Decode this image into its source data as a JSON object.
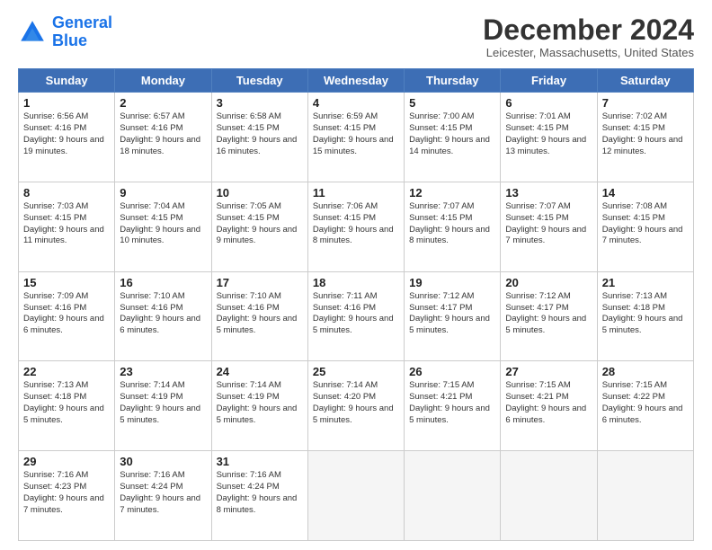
{
  "header": {
    "logo": {
      "line1": "General",
      "line2": "Blue"
    },
    "title": "December 2024",
    "location": "Leicester, Massachusetts, United States"
  },
  "columns": [
    "Sunday",
    "Monday",
    "Tuesday",
    "Wednesday",
    "Thursday",
    "Friday",
    "Saturday"
  ],
  "weeks": [
    [
      {
        "day": "1",
        "sunrise": "6:56 AM",
        "sunset": "4:16 PM",
        "daylight": "9 hours and 19 minutes."
      },
      {
        "day": "2",
        "sunrise": "6:57 AM",
        "sunset": "4:16 PM",
        "daylight": "9 hours and 18 minutes."
      },
      {
        "day": "3",
        "sunrise": "6:58 AM",
        "sunset": "4:15 PM",
        "daylight": "9 hours and 16 minutes."
      },
      {
        "day": "4",
        "sunrise": "6:59 AM",
        "sunset": "4:15 PM",
        "daylight": "9 hours and 15 minutes."
      },
      {
        "day": "5",
        "sunrise": "7:00 AM",
        "sunset": "4:15 PM",
        "daylight": "9 hours and 14 minutes."
      },
      {
        "day": "6",
        "sunrise": "7:01 AM",
        "sunset": "4:15 PM",
        "daylight": "9 hours and 13 minutes."
      },
      {
        "day": "7",
        "sunrise": "7:02 AM",
        "sunset": "4:15 PM",
        "daylight": "9 hours and 12 minutes."
      }
    ],
    [
      {
        "day": "8",
        "sunrise": "7:03 AM",
        "sunset": "4:15 PM",
        "daylight": "9 hours and 11 minutes."
      },
      {
        "day": "9",
        "sunrise": "7:04 AM",
        "sunset": "4:15 PM",
        "daylight": "9 hours and 10 minutes."
      },
      {
        "day": "10",
        "sunrise": "7:05 AM",
        "sunset": "4:15 PM",
        "daylight": "9 hours and 9 minutes."
      },
      {
        "day": "11",
        "sunrise": "7:06 AM",
        "sunset": "4:15 PM",
        "daylight": "9 hours and 8 minutes."
      },
      {
        "day": "12",
        "sunrise": "7:07 AM",
        "sunset": "4:15 PM",
        "daylight": "9 hours and 8 minutes."
      },
      {
        "day": "13",
        "sunrise": "7:07 AM",
        "sunset": "4:15 PM",
        "daylight": "9 hours and 7 minutes."
      },
      {
        "day": "14",
        "sunrise": "7:08 AM",
        "sunset": "4:15 PM",
        "daylight": "9 hours and 7 minutes."
      }
    ],
    [
      {
        "day": "15",
        "sunrise": "7:09 AM",
        "sunset": "4:16 PM",
        "daylight": "9 hours and 6 minutes."
      },
      {
        "day": "16",
        "sunrise": "7:10 AM",
        "sunset": "4:16 PM",
        "daylight": "9 hours and 6 minutes."
      },
      {
        "day": "17",
        "sunrise": "7:10 AM",
        "sunset": "4:16 PM",
        "daylight": "9 hours and 5 minutes."
      },
      {
        "day": "18",
        "sunrise": "7:11 AM",
        "sunset": "4:16 PM",
        "daylight": "9 hours and 5 minutes."
      },
      {
        "day": "19",
        "sunrise": "7:12 AM",
        "sunset": "4:17 PM",
        "daylight": "9 hours and 5 minutes."
      },
      {
        "day": "20",
        "sunrise": "7:12 AM",
        "sunset": "4:17 PM",
        "daylight": "9 hours and 5 minutes."
      },
      {
        "day": "21",
        "sunrise": "7:13 AM",
        "sunset": "4:18 PM",
        "daylight": "9 hours and 5 minutes."
      }
    ],
    [
      {
        "day": "22",
        "sunrise": "7:13 AM",
        "sunset": "4:18 PM",
        "daylight": "9 hours and 5 minutes."
      },
      {
        "day": "23",
        "sunrise": "7:14 AM",
        "sunset": "4:19 PM",
        "daylight": "9 hours and 5 minutes."
      },
      {
        "day": "24",
        "sunrise": "7:14 AM",
        "sunset": "4:19 PM",
        "daylight": "9 hours and 5 minutes."
      },
      {
        "day": "25",
        "sunrise": "7:14 AM",
        "sunset": "4:20 PM",
        "daylight": "9 hours and 5 minutes."
      },
      {
        "day": "26",
        "sunrise": "7:15 AM",
        "sunset": "4:21 PM",
        "daylight": "9 hours and 5 minutes."
      },
      {
        "day": "27",
        "sunrise": "7:15 AM",
        "sunset": "4:21 PM",
        "daylight": "9 hours and 6 minutes."
      },
      {
        "day": "28",
        "sunrise": "7:15 AM",
        "sunset": "4:22 PM",
        "daylight": "9 hours and 6 minutes."
      }
    ],
    [
      {
        "day": "29",
        "sunrise": "7:16 AM",
        "sunset": "4:23 PM",
        "daylight": "9 hours and 7 minutes."
      },
      {
        "day": "30",
        "sunrise": "7:16 AM",
        "sunset": "4:24 PM",
        "daylight": "9 hours and 7 minutes."
      },
      {
        "day": "31",
        "sunrise": "7:16 AM",
        "sunset": "4:24 PM",
        "daylight": "9 hours and 8 minutes."
      },
      null,
      null,
      null,
      null
    ]
  ]
}
